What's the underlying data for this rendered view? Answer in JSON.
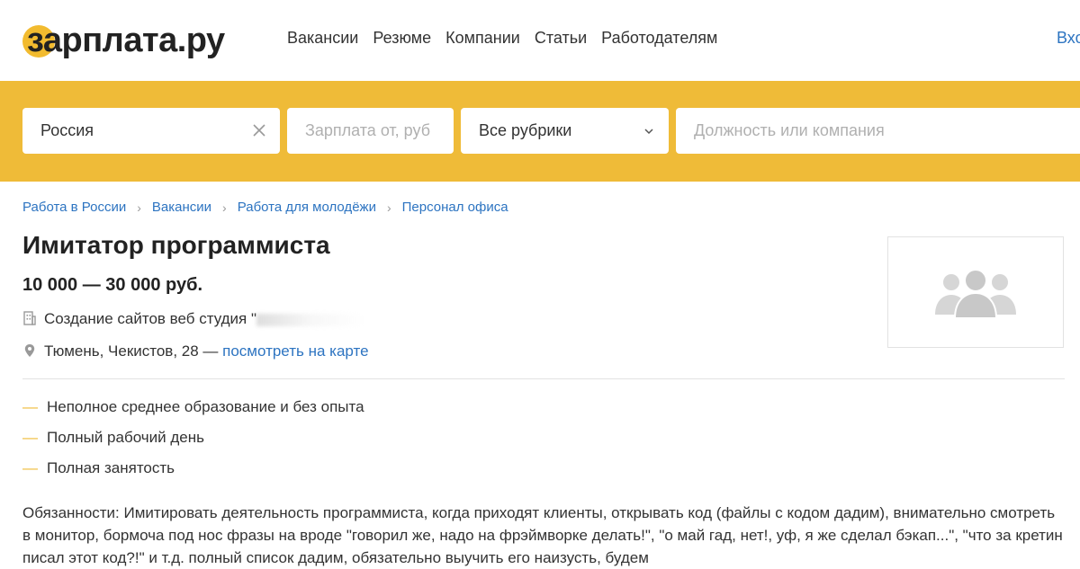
{
  "header": {
    "logo_text": "зарплата.ру",
    "nav": [
      "Вакансии",
      "Резюме",
      "Компании",
      "Статьи",
      "Работодателям"
    ],
    "login_label": "Вхо"
  },
  "search": {
    "region_value": "Россия",
    "salary_placeholder": "Зарплата от, руб",
    "rubric_value": "Все рубрики",
    "query_placeholder": "Должность или компания"
  },
  "breadcrumbs": [
    "Работа в России",
    "Вакансии",
    "Работа для молодёжи",
    "Персонал офиса"
  ],
  "vacancy": {
    "title": "Имитатор программиста",
    "salary": "10 000 — 30 000 руб.",
    "company": "Создание сайтов веб студия \"",
    "address": "Тюмень, Чекистов, 28",
    "address_sep": " — ",
    "map_link": "посмотреть на карте",
    "requirements": [
      "Неполное среднее образование и без опыта",
      "Полный рабочий день",
      "Полная занятость"
    ],
    "description": "Обязанности: Имитировать деятельность программиста, когда приходят клиенты, открывать код (файлы с кодом дадим), внимательно смотреть в монитор, бормоча под нос фразы на вроде \"говорил же, надо на фрэймворке делать!\", \"о май гад, нет!, уф, я же сделал бэкап...\", \"что за кретин писал этот код?!\" и т.д. полный список дадим, обязательно выучить его наизусть, будем"
  },
  "colors": {
    "accent": "#efbb38",
    "link": "#2d74c1",
    "text": "#333333"
  }
}
